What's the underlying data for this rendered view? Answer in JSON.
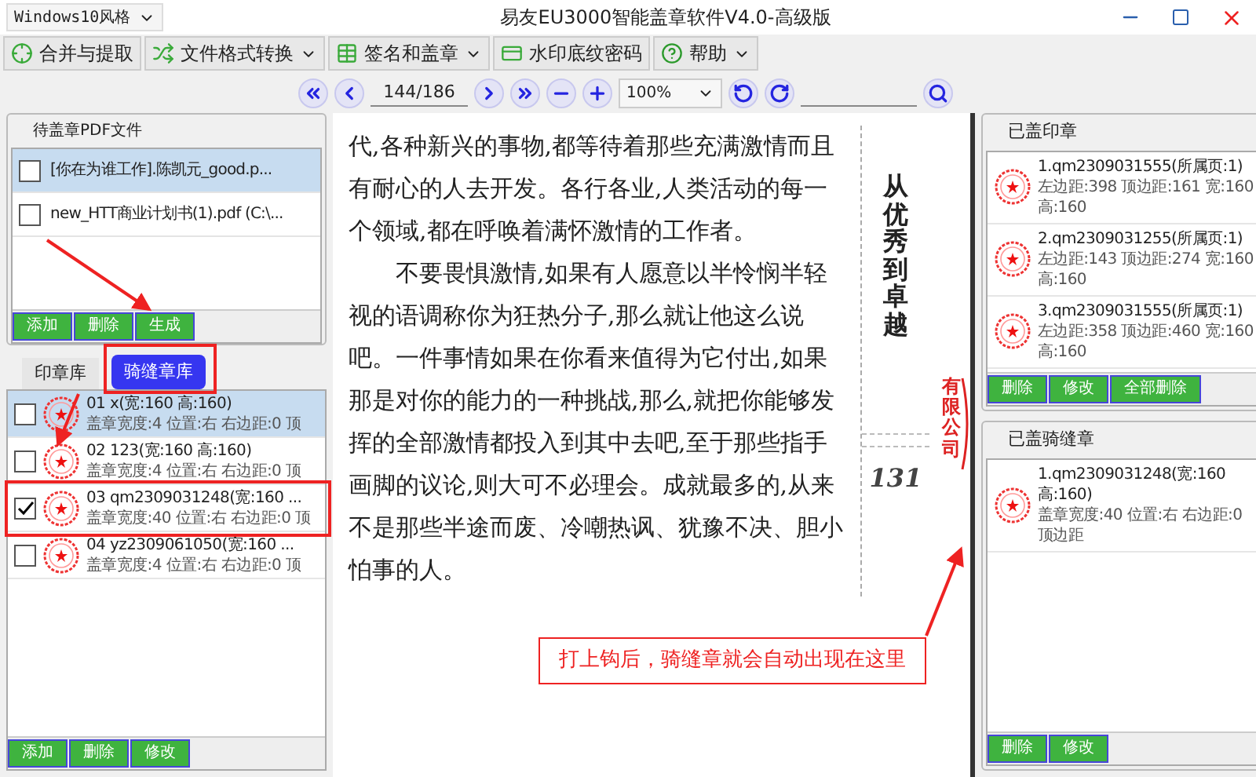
{
  "window": {
    "style_select": "Windows10风格",
    "title": "易友EU3000智能盖章软件V4.0-高级版"
  },
  "toolbar": [
    {
      "label": "合并与提取",
      "dropdown": false
    },
    {
      "label": "文件格式转换",
      "dropdown": true
    },
    {
      "label": "签名和盖章",
      "dropdown": true
    },
    {
      "label": "水印底纹密码",
      "dropdown": false
    },
    {
      "label": "帮助",
      "dropdown": true
    }
  ],
  "navigation": {
    "page": "144/186",
    "zoom": "100%"
  },
  "pdf_files": {
    "title": "待盖章PDF文件",
    "items": [
      {
        "name": "[你在为谁工作].陈凯元_good.p...",
        "checked": false,
        "selected": true
      },
      {
        "name": "new_HTT商业计划书(1).pdf (C:\\...",
        "checked": false,
        "selected": false
      }
    ],
    "buttons": [
      "添加",
      "删除",
      "生成"
    ]
  },
  "seal_tabs": [
    {
      "label": "印章库",
      "selected": false
    },
    {
      "label": "骑缝章库",
      "selected": true
    }
  ],
  "seals": {
    "items": [
      {
        "name": "01 x(宽:160 高:160)",
        "details": "盖章宽度:4 位置:右 右边距:0 顶",
        "checked": false,
        "selected": true
      },
      {
        "name": "02 123(宽:160 高:160)",
        "details": "盖章宽度:4 位置:右 右边距:0 顶",
        "checked": false,
        "selected": false
      },
      {
        "name": "03 qm2309031248(宽:160 ...",
        "details": "盖章宽度:40 位置:右 右边距:0 顶",
        "checked": true,
        "selected": false
      },
      {
        "name": "04 yz2309061050(宽:160 ...",
        "details": "盖章宽度:4 位置:右 右边距:0 顶",
        "checked": false,
        "selected": false
      }
    ],
    "buttons": [
      "添加",
      "删除",
      "修改"
    ]
  },
  "document": {
    "paragraphs": [
      "代,各种新兴的事物,都等待着那些充满激情而且有耐心的人去开发。各行各业,人类活动的每一个领域,都在呼唤着满怀激情的工作者。",
      "不要畏惧激情,如果有人愿意以半怜悯半轻视的语调称你为狂热分子,那么就让他这么说吧。一件事情如果在你看来值得为它付出,如果那是对你的能力的一种挑战,那么,就把你能够发挥的全部激情都投入到其中去吧,至于那些指手画脚的议论,则大可不必理会。成就最多的,从来不是那些半途而废、冷嘲热讽、犹豫不决、胆小怕事的人。"
    ],
    "side_title": "从优秀到卓越",
    "page_number": "131",
    "stamp_text": "有限公司"
  },
  "callout": "打上钩后，骑缝章就会自动出现在这里",
  "applied_seals": {
    "title": "已盖印章",
    "items": [
      {
        "name": "1.qm2309031555(所属页:1)",
        "details": "左边距:398 顶边距:161 宽:160 高:160"
      },
      {
        "name": "2.qm2309031255(所属页:1)",
        "details": "左边距:143 顶边距:274 宽:160 高:160"
      },
      {
        "name": "3.qm2309031555(所属页:1)",
        "details": "左边距:358 顶边距:460 宽:160 高:160"
      }
    ],
    "buttons": [
      "删除",
      "修改",
      "全部删除"
    ]
  },
  "applied_seam_seals": {
    "title": "已盖骑缝章",
    "items": [
      {
        "name": "1.qm2309031248(宽:160 高:160)",
        "details": "盖章宽度:40 位置:右 右边距:0 顶边距"
      }
    ],
    "buttons": [
      "删除",
      "修改"
    ]
  }
}
